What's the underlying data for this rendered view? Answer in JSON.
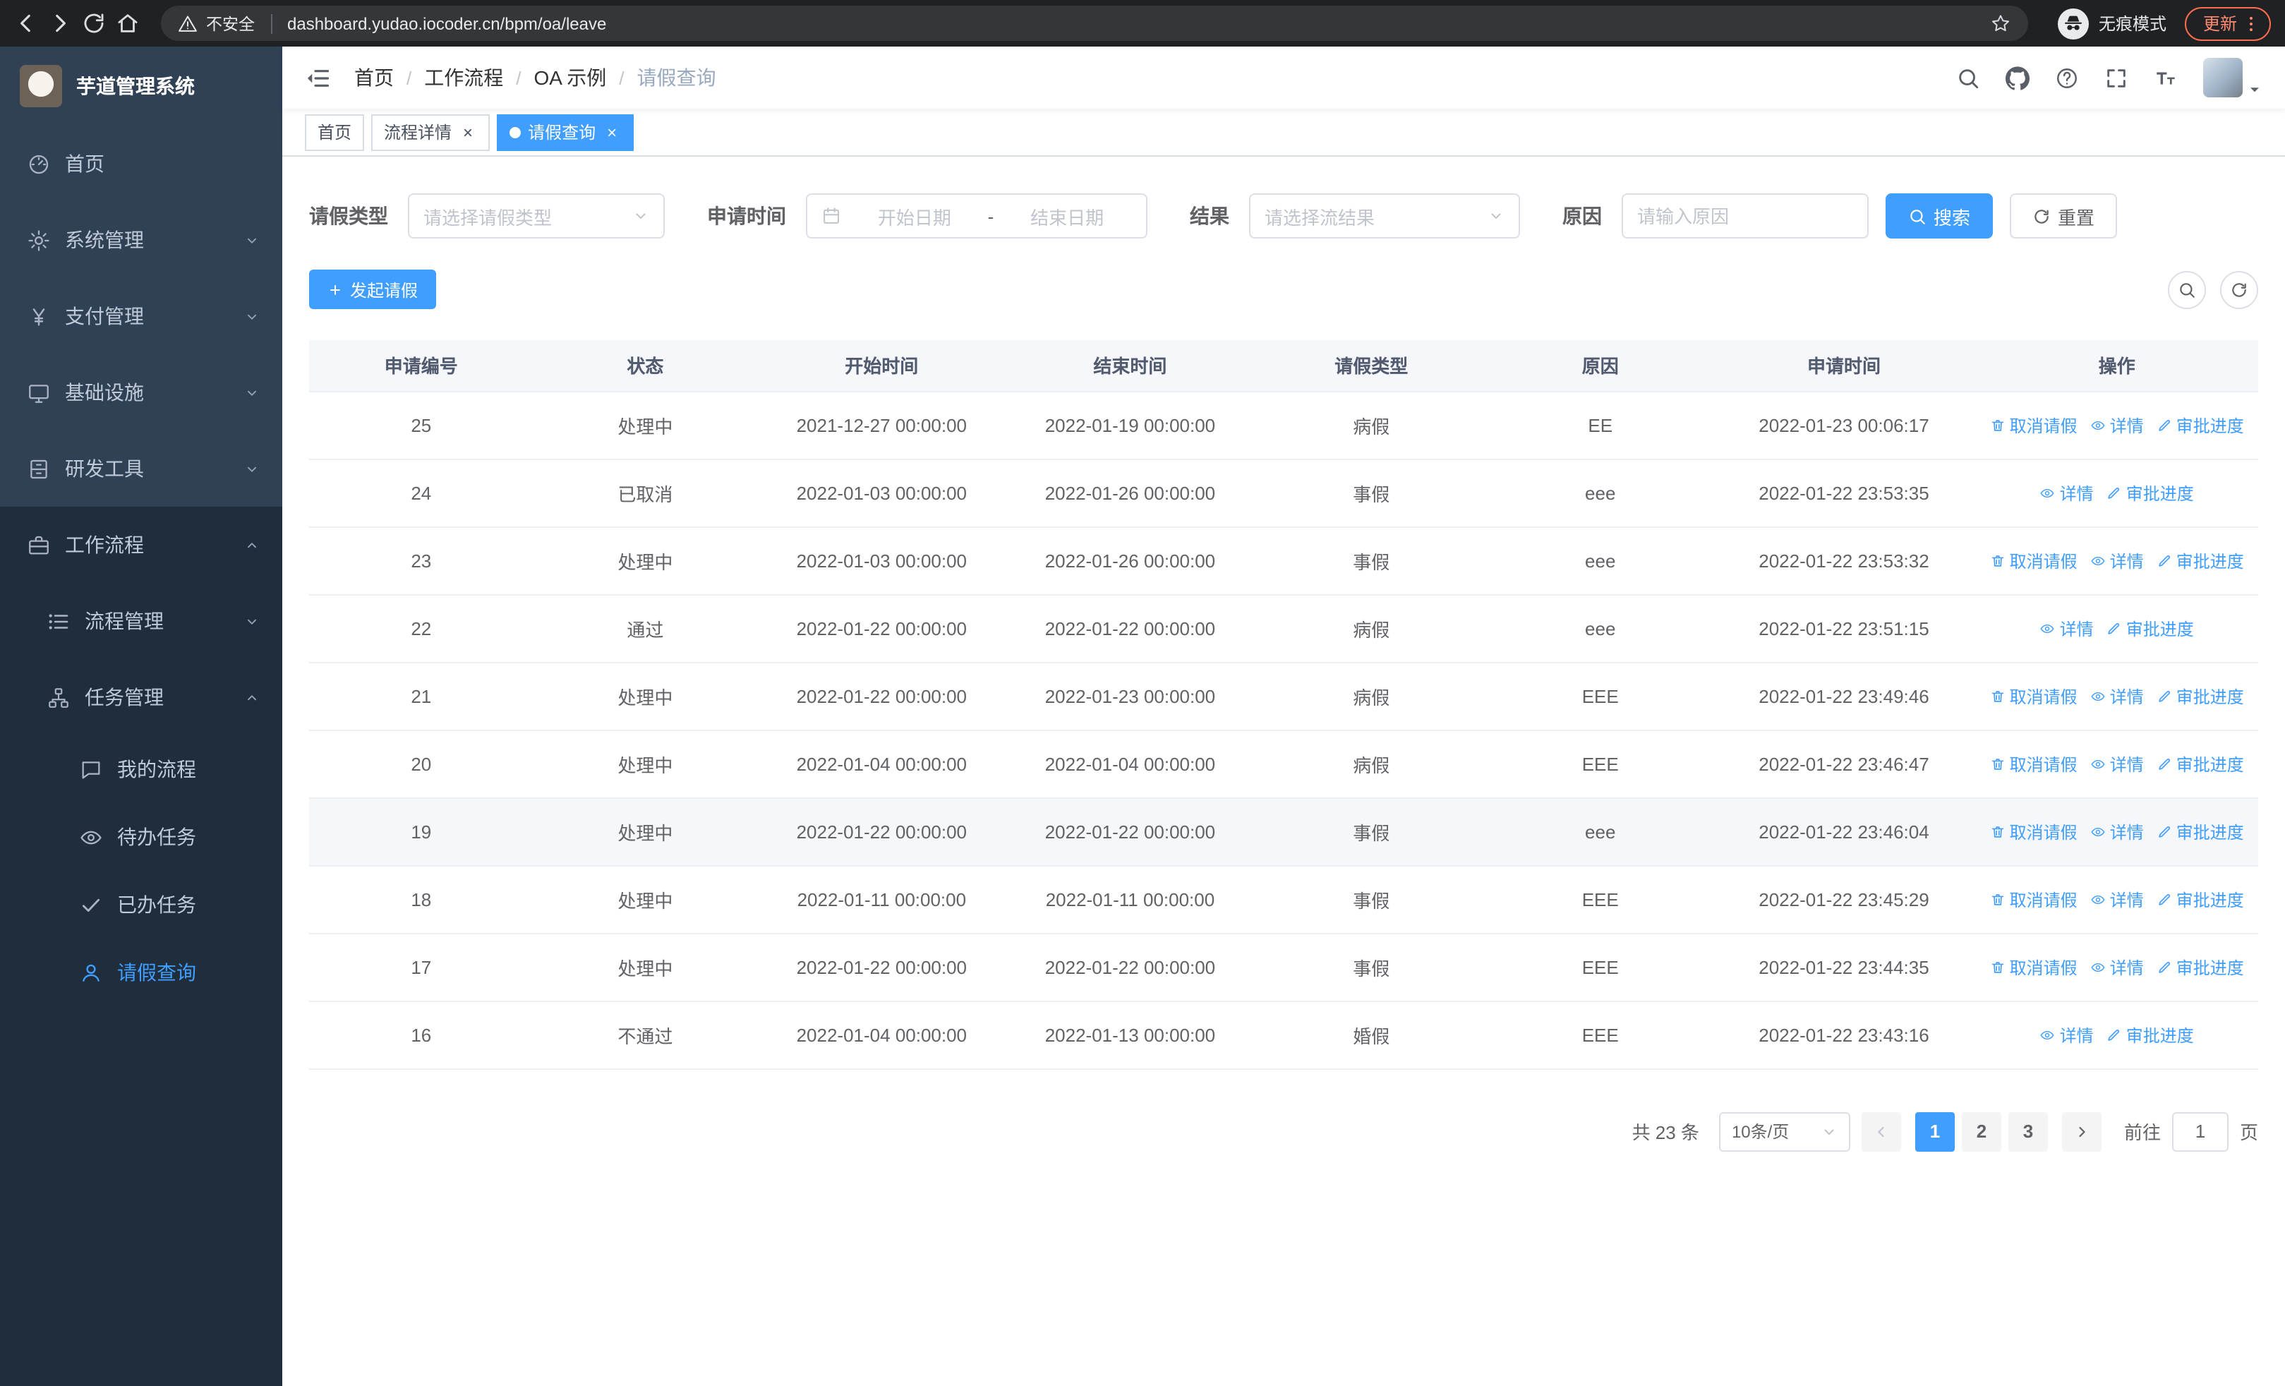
{
  "colors": {
    "accent": "#409eff",
    "sidebar_bg": "#304156",
    "sidebar_dark": "#1f2d3d",
    "chrome_bg": "#202124",
    "update_accent": "#ff6d4d"
  },
  "browser": {
    "security_warning": "不安全",
    "url": "dashboard.yudao.iocoder.cn/bpm/oa/leave",
    "incognito_label": "无痕模式",
    "update_label": "更新"
  },
  "sidebar": {
    "app_title": "芋道管理系统",
    "items": [
      {
        "name": "home",
        "icon": "dashboard",
        "label": "首页",
        "level": 1
      },
      {
        "name": "system",
        "icon": "gear",
        "label": "系统管理",
        "level": 1,
        "chevron": "down"
      },
      {
        "name": "payment",
        "icon": "yen",
        "label": "支付管理",
        "level": 1,
        "chevron": "down"
      },
      {
        "name": "infra",
        "icon": "monitor",
        "label": "基础设施",
        "level": 1,
        "chevron": "down"
      },
      {
        "name": "devtools",
        "icon": "cabinet",
        "label": "研发工具",
        "level": 1,
        "chevron": "down"
      },
      {
        "name": "workflow",
        "icon": "briefcase",
        "label": "工作流程",
        "level": 1,
        "chevron": "up",
        "expanded": true
      },
      {
        "name": "process-mgmt",
        "icon": "list",
        "label": "流程管理",
        "level": 2,
        "chevron": "down"
      },
      {
        "name": "task-mgmt",
        "icon": "tree",
        "label": "任务管理",
        "level": 2,
        "chevron": "up",
        "expanded": true
      },
      {
        "name": "my-process",
        "icon": "chat",
        "label": "我的流程",
        "level": 3
      },
      {
        "name": "todo-task",
        "icon": "eye",
        "label": "待办任务",
        "level": 3
      },
      {
        "name": "done-task",
        "icon": "check",
        "label": "已办任务",
        "level": 3
      },
      {
        "name": "leave-query",
        "icon": "user",
        "label": "请假查询",
        "level": 3,
        "active": true
      }
    ]
  },
  "header": {
    "actions": [
      {
        "name": "search-icon",
        "icon": "search"
      },
      {
        "name": "github-icon",
        "icon": "github"
      },
      {
        "name": "help-icon",
        "icon": "question"
      },
      {
        "name": "fullscreen-icon",
        "icon": "fullscreen"
      },
      {
        "name": "font-size-icon",
        "icon": "fontsize"
      }
    ]
  },
  "breadcrumb": [
    "首页",
    "工作流程",
    "OA 示例",
    "请假查询"
  ],
  "tabs": [
    {
      "name": "home",
      "label": "首页",
      "closable": false,
      "active": false
    },
    {
      "name": "process-detail",
      "label": "流程详情",
      "closable": true,
      "active": false
    },
    {
      "name": "leave-query",
      "label": "请假查询",
      "closable": true,
      "active": true
    }
  ],
  "filters": {
    "leave_type": {
      "label": "请假类型",
      "placeholder": "请选择请假类型"
    },
    "apply_time": {
      "label": "申请时间",
      "start_placeholder": "开始日期",
      "separator": "-",
      "end_placeholder": "结束日期"
    },
    "result": {
      "label": "结果",
      "placeholder": "请选择流结果"
    },
    "reason": {
      "label": "原因",
      "placeholder": "请输入原因"
    },
    "search_label": "搜索",
    "reset_label": "重置"
  },
  "toolbar": {
    "create_label": "发起请假"
  },
  "table": {
    "columns": [
      "申请编号",
      "状态",
      "开始时间",
      "结束时间",
      "请假类型",
      "原因",
      "申请时间",
      "操作"
    ],
    "op_defs": {
      "cancel": {
        "label": "取消请假",
        "icon": "trash"
      },
      "detail": {
        "label": "详情",
        "icon": "eye"
      },
      "progress": {
        "label": "审批进度",
        "icon": "edit"
      }
    },
    "rows": [
      {
        "id": "25",
        "status": "处理中",
        "start": "2021-12-27 00:00:00",
        "end": "2022-01-19 00:00:00",
        "type": "病假",
        "reason": "EE",
        "applied": "2022-01-23 00:06:17",
        "ops": [
          "cancel",
          "detail",
          "progress"
        ]
      },
      {
        "id": "24",
        "status": "已取消",
        "start": "2022-01-03 00:00:00",
        "end": "2022-01-26 00:00:00",
        "type": "事假",
        "reason": "eee",
        "applied": "2022-01-22 23:53:35",
        "ops": [
          "detail",
          "progress"
        ]
      },
      {
        "id": "23",
        "status": "处理中",
        "start": "2022-01-03 00:00:00",
        "end": "2022-01-26 00:00:00",
        "type": "事假",
        "reason": "eee",
        "applied": "2022-01-22 23:53:32",
        "ops": [
          "cancel",
          "detail",
          "progress"
        ]
      },
      {
        "id": "22",
        "status": "通过",
        "start": "2022-01-22 00:00:00",
        "end": "2022-01-22 00:00:00",
        "type": "病假",
        "reason": "eee",
        "applied": "2022-01-22 23:51:15",
        "ops": [
          "detail",
          "progress"
        ]
      },
      {
        "id": "21",
        "status": "处理中",
        "start": "2022-01-22 00:00:00",
        "end": "2022-01-23 00:00:00",
        "type": "病假",
        "reason": "EEE",
        "applied": "2022-01-22 23:49:46",
        "ops": [
          "cancel",
          "detail",
          "progress"
        ]
      },
      {
        "id": "20",
        "status": "处理中",
        "start": "2022-01-04 00:00:00",
        "end": "2022-01-04 00:00:00",
        "type": "病假",
        "reason": "EEE",
        "applied": "2022-01-22 23:46:47",
        "ops": [
          "cancel",
          "detail",
          "progress"
        ]
      },
      {
        "id": "19",
        "status": "处理中",
        "start": "2022-01-22 00:00:00",
        "end": "2022-01-22 00:00:00",
        "type": "事假",
        "reason": "eee",
        "applied": "2022-01-22 23:46:04",
        "ops": [
          "cancel",
          "detail",
          "progress"
        ],
        "highlighted": true
      },
      {
        "id": "18",
        "status": "处理中",
        "start": "2022-01-11 00:00:00",
        "end": "2022-01-11 00:00:00",
        "type": "事假",
        "reason": "EEE",
        "applied": "2022-01-22 23:45:29",
        "ops": [
          "cancel",
          "detail",
          "progress"
        ]
      },
      {
        "id": "17",
        "status": "处理中",
        "start": "2022-01-22 00:00:00",
        "end": "2022-01-22 00:00:00",
        "type": "事假",
        "reason": "EEE",
        "applied": "2022-01-22 23:44:35",
        "ops": [
          "cancel",
          "detail",
          "progress"
        ]
      },
      {
        "id": "16",
        "status": "不通过",
        "start": "2022-01-04 00:00:00",
        "end": "2022-01-13 00:00:00",
        "type": "婚假",
        "reason": "EEE",
        "applied": "2022-01-22 23:43:16",
        "ops": [
          "detail",
          "progress"
        ]
      }
    ]
  },
  "pagination": {
    "total": "共 23 条",
    "page_size": "10条/页",
    "pages": [
      "1",
      "2",
      "3"
    ],
    "current": "1",
    "goto_label": "前往",
    "goto_value": "1",
    "page_suffix": "页"
  }
}
